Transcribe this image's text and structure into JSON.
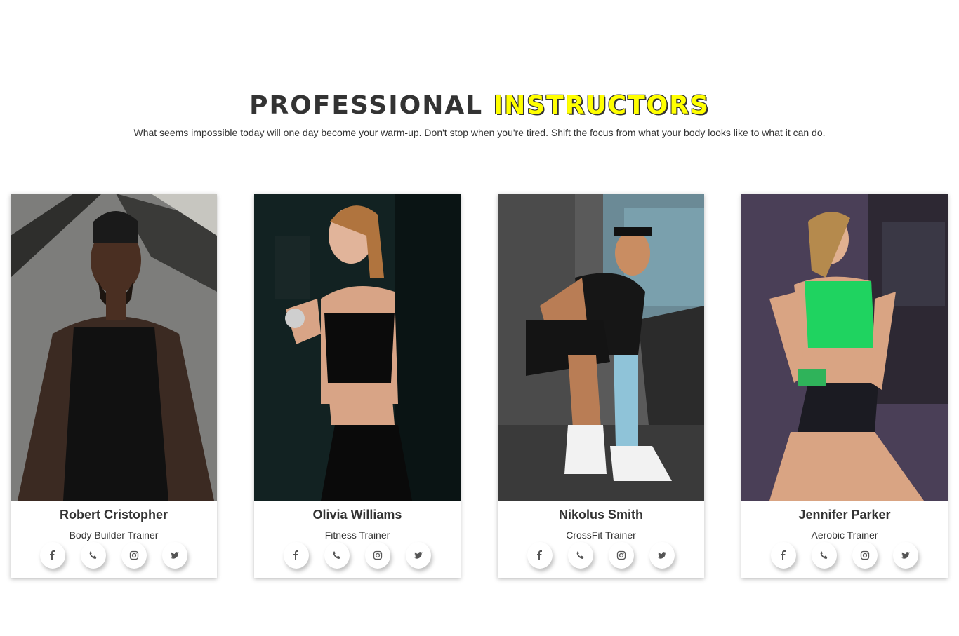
{
  "header": {
    "title_dark": "PROFESSIONAL",
    "title_accent": "INSTRUCTORS",
    "subtitle": "What seems impossible today will one day become your warm-up. Don't stop when you're tired. Shift the focus from what your body looks like to what it can do.",
    "accent_color": "#ffff00"
  },
  "trainers": [
    {
      "name": "Robert Cristopher",
      "role": "Body Builder Trainer"
    },
    {
      "name": "Olivia Williams",
      "role": "Fitness Trainer"
    },
    {
      "name": "Nikolus Smith",
      "role": "CrossFit Trainer"
    },
    {
      "name": "Jennifer Parker",
      "role": "Aerobic Trainer"
    }
  ],
  "social_icons": [
    "facebook-icon",
    "phone-icon",
    "instagram-icon",
    "twitter-icon"
  ]
}
